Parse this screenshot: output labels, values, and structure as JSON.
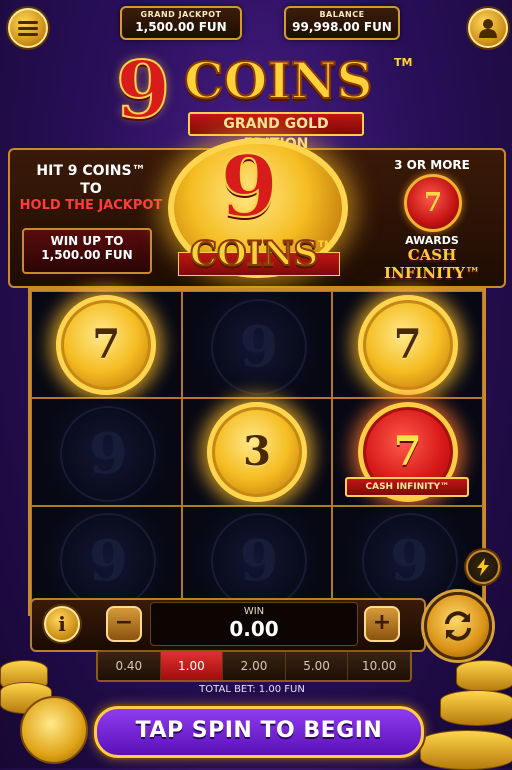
{
  "header": {
    "jackpot_caption": "GRAND JACKPOT",
    "jackpot_value": "1,500.00 FUN",
    "balance_caption": "BALANCE",
    "balance_value": "99,998.00 FUN"
  },
  "logo": {
    "nine": "9",
    "coins": "COINS",
    "tm": "TM",
    "edition": "GRAND GOLD EDITION"
  },
  "info": {
    "hit_line1": "HIT 9 COINS™",
    "hit_line2": "TO",
    "hit_line3": "HOLD THE JACKPOT",
    "win_up_line1": "WIN UP TO",
    "win_up_line2": "1,500.00 FUN",
    "center_nine": "9",
    "center_coins": "COINS",
    "center_tm": "TM",
    "three_or_more": "3 OR MORE",
    "award_coin_value": "7",
    "awards": "AWARDS",
    "cash_infinity": "CASH INFINITY™"
  },
  "grid": {
    "cells": [
      {
        "type": "gold",
        "value": "7"
      },
      {
        "type": "empty",
        "value": "9"
      },
      {
        "type": "gold",
        "value": "7"
      },
      {
        "type": "empty",
        "value": "9"
      },
      {
        "type": "gold",
        "value": "3"
      },
      {
        "type": "red",
        "value": "7",
        "label": "CASH INFINITY™"
      },
      {
        "type": "empty",
        "value": "9"
      },
      {
        "type": "empty",
        "value": "9"
      },
      {
        "type": "empty",
        "value": "9"
      }
    ]
  },
  "controls": {
    "info_label": "i",
    "minus_label": "−",
    "plus_label": "+",
    "win_caption": "WIN",
    "win_value": "0.00",
    "bets": [
      "0.40",
      "1.00",
      "2.00",
      "5.00",
      "10.00"
    ],
    "selected_bet": "1.00",
    "total_bet": "TOTAL BET: 1.00 FUN",
    "spin_label": "TAP SPIN TO BEGIN"
  },
  "icons": {
    "menu": "menu-icon",
    "account": "user-icon",
    "lightning": "lightning-icon",
    "spin": "refresh-arrows-icon",
    "info": "info-icon"
  }
}
